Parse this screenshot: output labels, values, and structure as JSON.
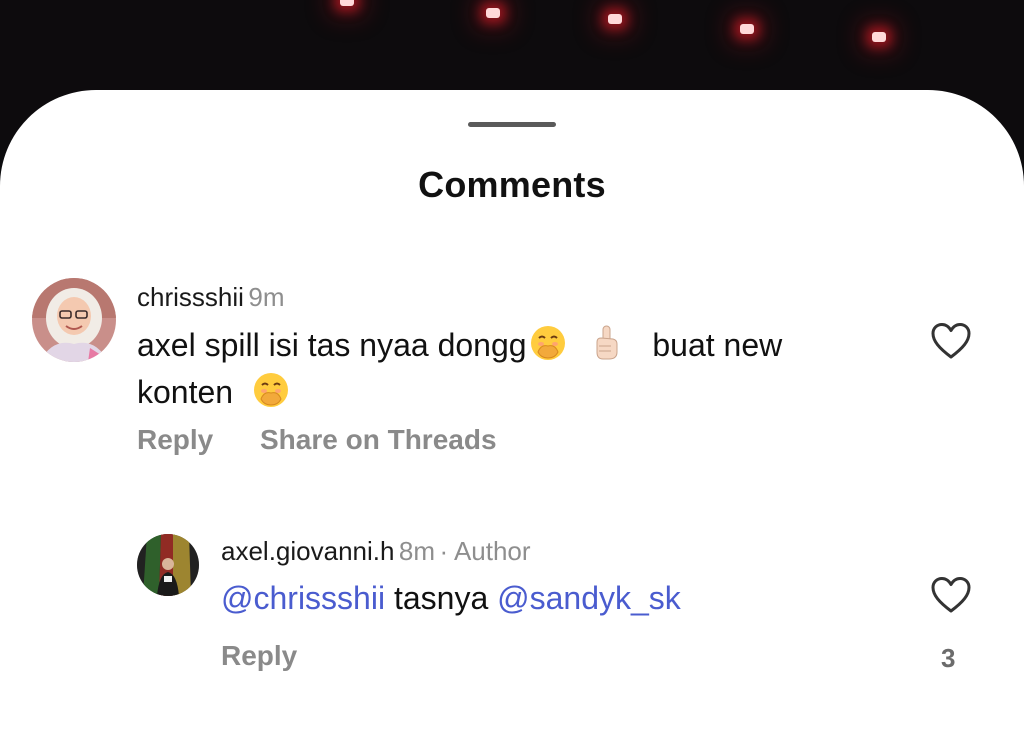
{
  "sheet": {
    "title": "Comments"
  },
  "comments": [
    {
      "username": "chrissshii",
      "time": "9m",
      "text_line1": "axel spill isi tas nyaa dongg",
      "text_mid": "buat new",
      "text_line2": "konten",
      "emojis": [
        "hand-over-mouth-emoji",
        "index-pointing-up-emoji",
        "hand-over-mouth-emoji"
      ],
      "actions": {
        "reply": "Reply",
        "share": "Share on Threads"
      }
    }
  ],
  "replies": [
    {
      "username": "axel.giovanni.h",
      "time": "8m",
      "badge": "· Author",
      "mention1": "@chrissshii",
      "text": "tasnya",
      "mention2": "@sandyk_sk",
      "actions": {
        "reply": "Reply"
      },
      "like_count": "3"
    }
  ],
  "colors": {
    "mention": "#4a5ccf",
    "muted": "#8e8e8e",
    "background_dark": "#0d0b0d"
  }
}
